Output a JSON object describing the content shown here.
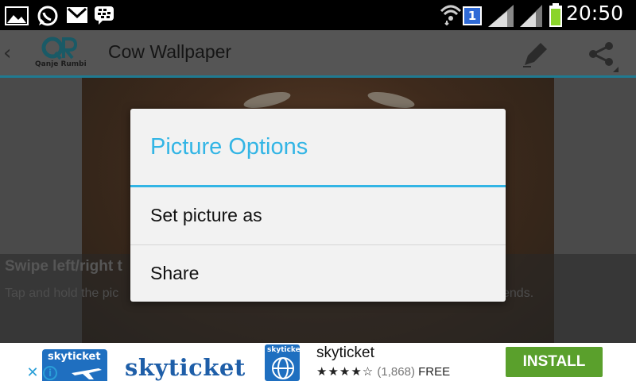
{
  "status_bar": {
    "time": "20:50",
    "sim_badge": "1",
    "icons": [
      "gallery-icon",
      "whatsapp-icon",
      "gmail-icon",
      "bbm-icon",
      "wifi-icon",
      "signal-icon",
      "signal-icon",
      "battery-icon"
    ]
  },
  "app_bar": {
    "logo_text": "QR",
    "logo_caption": "Qanje Rumbi",
    "title": "Cow Wallpaper",
    "icons": [
      "pen-icon",
      "share-icon"
    ]
  },
  "hint": {
    "title": "Swipe left/right t",
    "text_start": "Tap and hold the pic",
    "text_end": "ends."
  },
  "dialog": {
    "title": "Picture Options",
    "items": [
      "Set picture as",
      "Share"
    ]
  },
  "ad": {
    "badge_text": "skyticket",
    "wordmark": "skyticket",
    "app_icon_text": "skyticket",
    "app_name": "skyticket",
    "stars": "★★★★☆",
    "rating_count": "(1,868)",
    "price": "FREE",
    "install_label": "INSTALL",
    "close_symbol": "✕",
    "info_symbol": "i"
  },
  "colors": {
    "accent": "#33b5e5",
    "install_green": "#5aa02c",
    "ad_blue": "#1f6fc0"
  }
}
